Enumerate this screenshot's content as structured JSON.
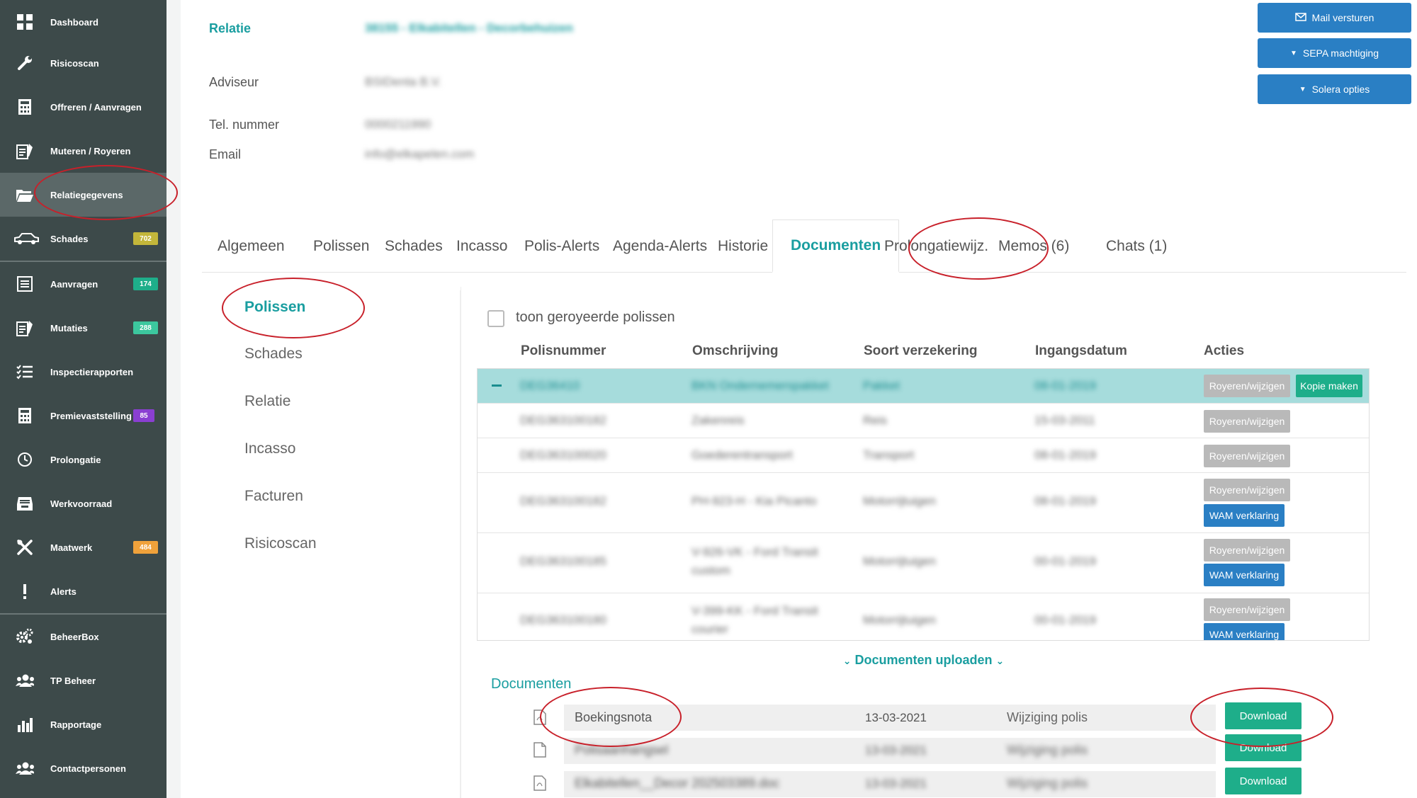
{
  "sidebar": {
    "items": [
      {
        "label": "Dashboard",
        "icon": "dashboard-icon"
      },
      {
        "label": "Risicoscan",
        "icon": "wrench-icon"
      },
      {
        "label": "Offreren / Aanvragen",
        "icon": "calculator-icon"
      },
      {
        "label": "Muteren / Royeren",
        "icon": "document-edit-icon"
      },
      {
        "label": "Relatiegegevens",
        "icon": "folder-open-icon"
      },
      {
        "label": "Schades",
        "icon": "car-icon",
        "badge": "702"
      },
      {
        "label": "Aanvragen",
        "icon": "list-icon",
        "badge": "174"
      },
      {
        "label": "Mutaties",
        "icon": "document-edit-icon",
        "badge": "288"
      },
      {
        "label": "Inspectierapporten",
        "icon": "checklist-icon"
      },
      {
        "label": "Premievaststelling",
        "icon": "calculator-icon",
        "badge": "85"
      },
      {
        "label": "Prolongatie",
        "icon": "clock-icon"
      },
      {
        "label": "Werkvoorraad",
        "icon": "inbox-icon"
      },
      {
        "label": "Maatwerk",
        "icon": "tools-icon",
        "badge": "484"
      },
      {
        "label": "Alerts",
        "icon": "exclamation-icon"
      },
      {
        "label": "BeheerBox",
        "icon": "gears-icon"
      },
      {
        "label": "TP Beheer",
        "icon": "users-icon"
      },
      {
        "label": "Rapportage",
        "icon": "bar-chart-icon"
      },
      {
        "label": "Contactpersonen",
        "icon": "users-icon"
      }
    ],
    "badge_colors": {
      "702": "#c3b63a",
      "174": "#1eae8a",
      "288": "#3cc79e",
      "85": "#8a3fd1",
      "484": "#f0a23b"
    }
  },
  "relation": {
    "relatie_label": "Relatie",
    "relatie_value": "38155 - Elkabitellen - Decorbehuizen",
    "adviseur_label": "Adviseur",
    "adviseur_value": "BSIDenta B.V.",
    "tel_label": "Tel. nummer",
    "tel_value": "0000211990",
    "email_label": "Email",
    "email_value": "info@elkapelen.com"
  },
  "actions": {
    "mail": "Mail versturen",
    "sepa": "SEPA machtiging",
    "solera": "Solera opties"
  },
  "tabs": [
    "Algemeen",
    "Polissen",
    "Schades",
    "Incasso",
    "Polis-Alerts",
    "Agenda-Alerts",
    "Historie",
    "Documenten",
    "Prolongatiewijz.",
    "Memos (6)",
    "Chats (1)"
  ],
  "subnav": [
    "Polissen",
    "Schades",
    "Relatie",
    "Incasso",
    "Facturen",
    "Risicoscan"
  ],
  "policies": {
    "show_cancelled_label": "toon geroyeerde polissen",
    "headers": [
      "Polisnummer",
      "Omschrijving",
      "Soort verzekering",
      "Ingangsdatum",
      "Acties"
    ],
    "rows": [
      {
        "nr": "DEG36410",
        "desc": "BKN Ondernemerspakket",
        "type": "Pakket",
        "date": "08-01-2019",
        "actions": [
          "Royeren/wijzigen",
          "Kopie maken"
        ]
      },
      {
        "nr": "DEG363100182",
        "desc": "Zakenreis",
        "type": "Reis",
        "date": "15-03-2011",
        "actions": [
          "Royeren/wijzigen"
        ]
      },
      {
        "nr": "DEG363100020",
        "desc": "Goederentransport",
        "type": "Transport",
        "date": "08-01-2019",
        "actions": [
          "Royeren/wijzigen"
        ]
      },
      {
        "nr": "DEG363100182",
        "desc": "PH-923-H - Kia Picanto",
        "type": "Motorrijtuigen",
        "date": "08-01-2019",
        "actions": [
          "Royeren/wijzigen",
          "WAM verklaring"
        ]
      },
      {
        "nr": "DEG363100185",
        "desc": "V-926-VK - Ford Transit custom",
        "type": "Motorrijtuigen",
        "date": "00-01-2019",
        "actions": [
          "Royeren/wijzigen",
          "WAM verklaring"
        ]
      },
      {
        "nr": "DEG363100180",
        "desc": "V-399-KK - Ford Transit courier",
        "type": "Motorrijtuigen",
        "date": "00-01-2019",
        "actions": [
          "Royeren/wijzigen",
          "WAM verklaring"
        ]
      }
    ]
  },
  "documents": {
    "upload_label": "Documenten uploaden",
    "title": "Documenten",
    "download_label": "Download",
    "items": [
      {
        "name": "Boekingsnota",
        "date": "13-03-2021",
        "type": "Wijziging polis",
        "icon": "pdf-file-icon"
      },
      {
        "name": "Polisaanhangsel",
        "date": "13-03-2021",
        "type": "Wijziging polis",
        "icon": "file-icon"
      },
      {
        "name": "Elkabitellen__Decor 202503389.doc",
        "date": "13-03-2021",
        "type": "Wijziging polis",
        "icon": "pdf-file-icon"
      }
    ]
  },
  "colors": {
    "accent": "#1a9ea0",
    "primary_button": "#2a7fc4",
    "success_button": "#1eae8a",
    "sidebar": "#3d4a4a",
    "highlight": "#c8202a"
  }
}
